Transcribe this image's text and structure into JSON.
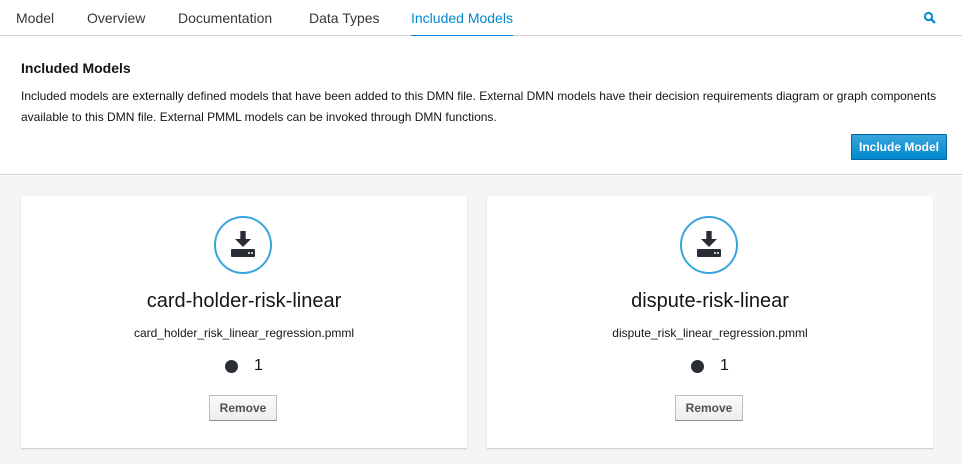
{
  "tabs": [
    {
      "label": "Model",
      "active": false
    },
    {
      "label": "Overview",
      "active": false
    },
    {
      "label": "Documentation",
      "active": false
    },
    {
      "label": "Data Types",
      "active": false
    },
    {
      "label": "Included Models",
      "active": true
    }
  ],
  "header": {
    "title": "Included Models",
    "description": "Included models are externally defined models that have been added to this DMN file. External DMN models have their decision requirements diagram or graph components available to this DMN file. External PMML models can be invoked through DMN functions.",
    "include_button_label": "Include Model"
  },
  "cards": [
    {
      "name": "card-holder-risk-linear",
      "file": "card_holder_risk_linear_regression.pmml",
      "count": "1",
      "remove_label": "Remove",
      "icon": "download-icon"
    },
    {
      "name": "dispute-risk-linear",
      "file": "dispute_risk_linear_regression.pmml",
      "count": "1",
      "remove_label": "Remove",
      "icon": "download-icon"
    }
  ],
  "colors": {
    "accent": "#0088ce",
    "primary_button": "#39a5dc",
    "background": "#f5f5f5"
  }
}
